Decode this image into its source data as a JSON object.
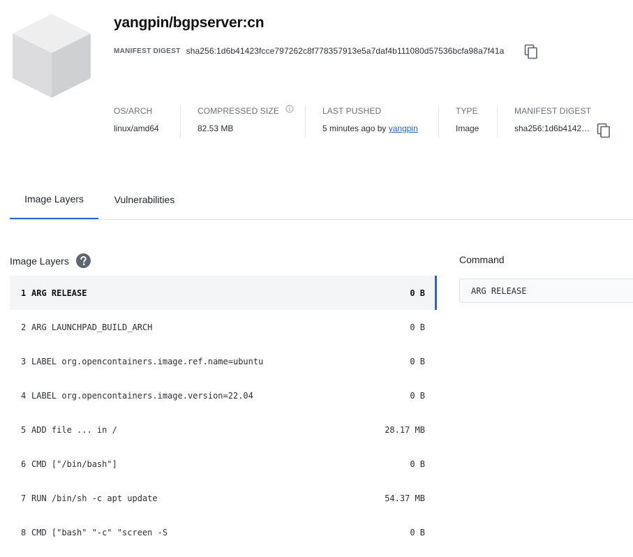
{
  "header": {
    "title": "yangpin/bgpserver:cn",
    "digest_label": "MANIFEST DIGEST",
    "digest_value": "sha256:1d6b41423fcce797262c8f778357913e5a7daf4b111080d57536bcfa98a7f41a"
  },
  "meta": [
    {
      "label": "OS/ARCH",
      "value": "linux/amd64"
    },
    {
      "label": "COMPRESSED SIZE",
      "value": "82.53 MB"
    },
    {
      "label": "LAST PUSHED",
      "value": "5 minutes ago by",
      "link": "yangpin"
    },
    {
      "label": "TYPE",
      "value": "Image"
    },
    {
      "label": "MANIFEST DIGEST",
      "value": "sha256:1d6b4142…"
    }
  ],
  "tabs": [
    {
      "label": "Image Layers",
      "active": true
    },
    {
      "label": "Vulnerabilities",
      "active": false
    }
  ],
  "layers_panel": {
    "heading": "Image Layers",
    "items": [
      {
        "num": "1",
        "cmd": "ARG RELEASE",
        "size": "0 B",
        "selected": true
      },
      {
        "num": "2",
        "cmd": "ARG LAUNCHPAD_BUILD_ARCH",
        "size": "0 B"
      },
      {
        "num": "3",
        "cmd": "LABEL org.opencontainers.image.ref.name=ubuntu",
        "size": "0 B"
      },
      {
        "num": "4",
        "cmd": "LABEL org.opencontainers.image.version=22.04",
        "size": "0 B"
      },
      {
        "num": "5",
        "cmd": "ADD file ... in /",
        "size": "28.17 MB"
      },
      {
        "num": "6",
        "cmd": "CMD [\"/bin/bash\"]",
        "size": "0 B"
      },
      {
        "num": "7",
        "cmd": "RUN /bin/sh -c apt update",
        "size": "54.37 MB"
      },
      {
        "num": "8",
        "cmd": "CMD [\"bash\" \"-c\" \"screen -S",
        "size": "0 B"
      }
    ]
  },
  "command_panel": {
    "heading": "Command",
    "value": "ARG RELEASE"
  },
  "colors": {
    "accent": "#2a64c8",
    "selected_bg": "#f4f5f7"
  },
  "icons": {
    "copy": "copy-icon",
    "info": "info-icon",
    "help": "help-icon",
    "image": "cube-icon"
  }
}
